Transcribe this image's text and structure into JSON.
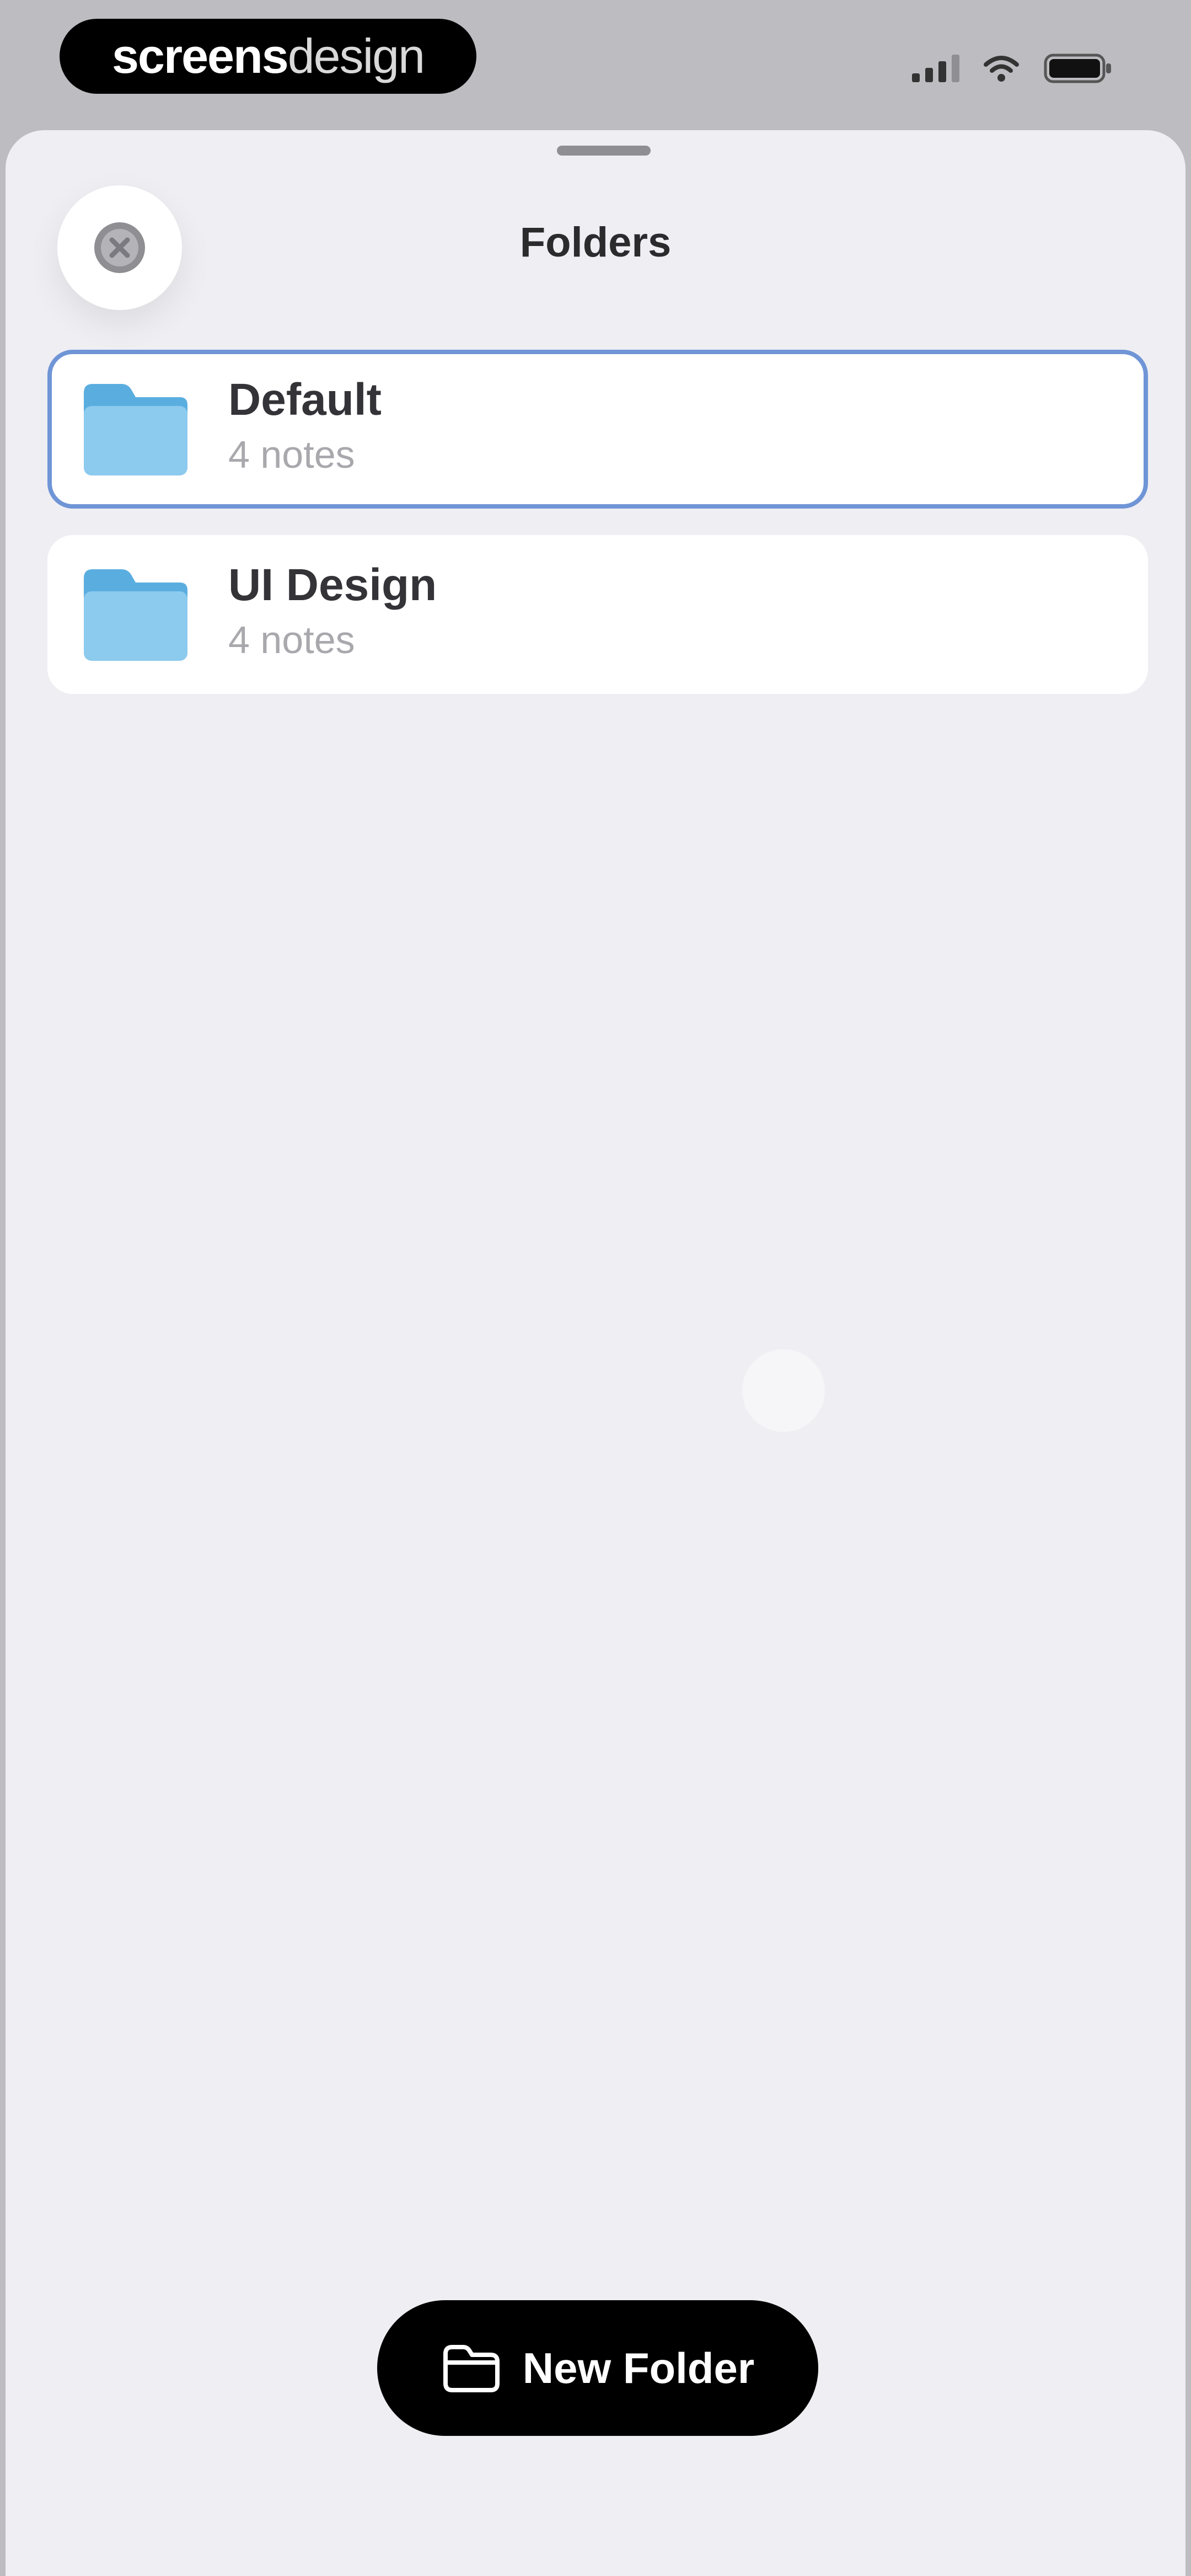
{
  "status_bar": {
    "brand_strong": "screens",
    "brand_light": "design",
    "icons": [
      "signal-icon",
      "wifi-icon",
      "battery-icon"
    ]
  },
  "sheet": {
    "title": "Folders",
    "close_icon": "close-circle-icon"
  },
  "folders": [
    {
      "name": "Default",
      "count": "4 notes",
      "selected": true,
      "icon": "folder-icon"
    },
    {
      "name": "UI Design",
      "count": "4 notes",
      "selected": false,
      "icon": "folder-icon"
    }
  ],
  "new_folder_button": {
    "label": "New Folder",
    "icon": "folder-plus-icon"
  },
  "colors": {
    "sheet_background": "#efeef3",
    "status_background": "#bdbcc1",
    "folder_blue": "#6fb8e6",
    "selection_border": "#6f95d6",
    "primary_button": "#000000"
  }
}
